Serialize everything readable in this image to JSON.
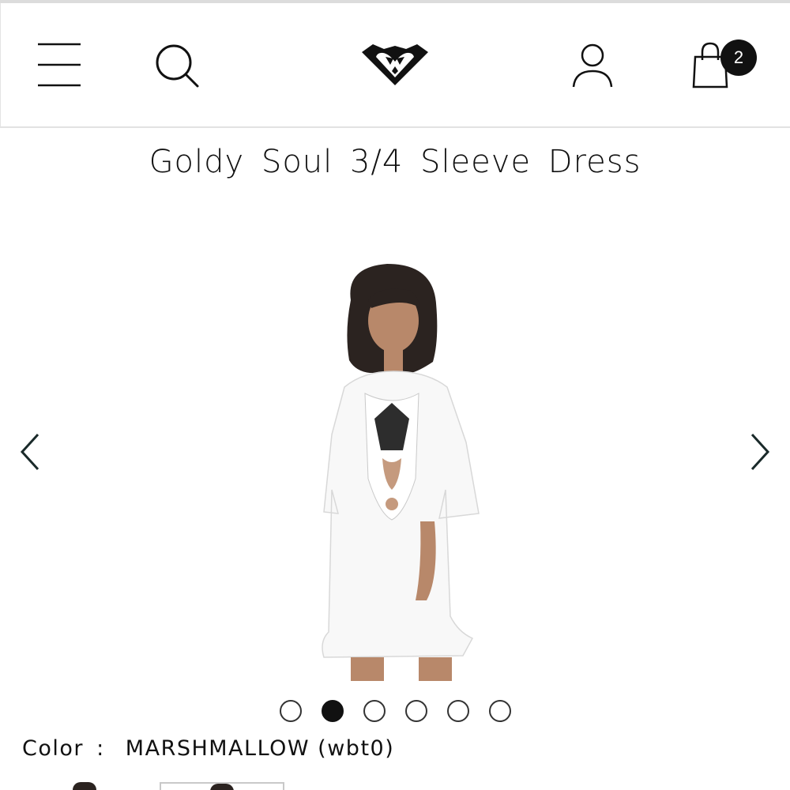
{
  "header": {
    "menu_icon": "hamburger-menu-icon",
    "search_icon": "search-icon",
    "logo": "roxy-heart-logo",
    "account_icon": "user-icon",
    "bag_icon": "shopping-bag-icon",
    "bag_count": "2"
  },
  "product": {
    "title": "Goldy Soul 3/4 Sleeve Dress",
    "color_label": "Color",
    "color_separator": ":",
    "color_value": "MARSHMALLOW (wbt0)"
  },
  "gallery": {
    "prev_icon": "chevron-left-icon",
    "next_icon": "chevron-right-icon",
    "image": "model-in-white-dress-photo",
    "slide_count": 6,
    "active_slide": 2
  },
  "colors": {
    "text": "#111111",
    "divider": "#e2e2e2",
    "badge": "#111111"
  }
}
